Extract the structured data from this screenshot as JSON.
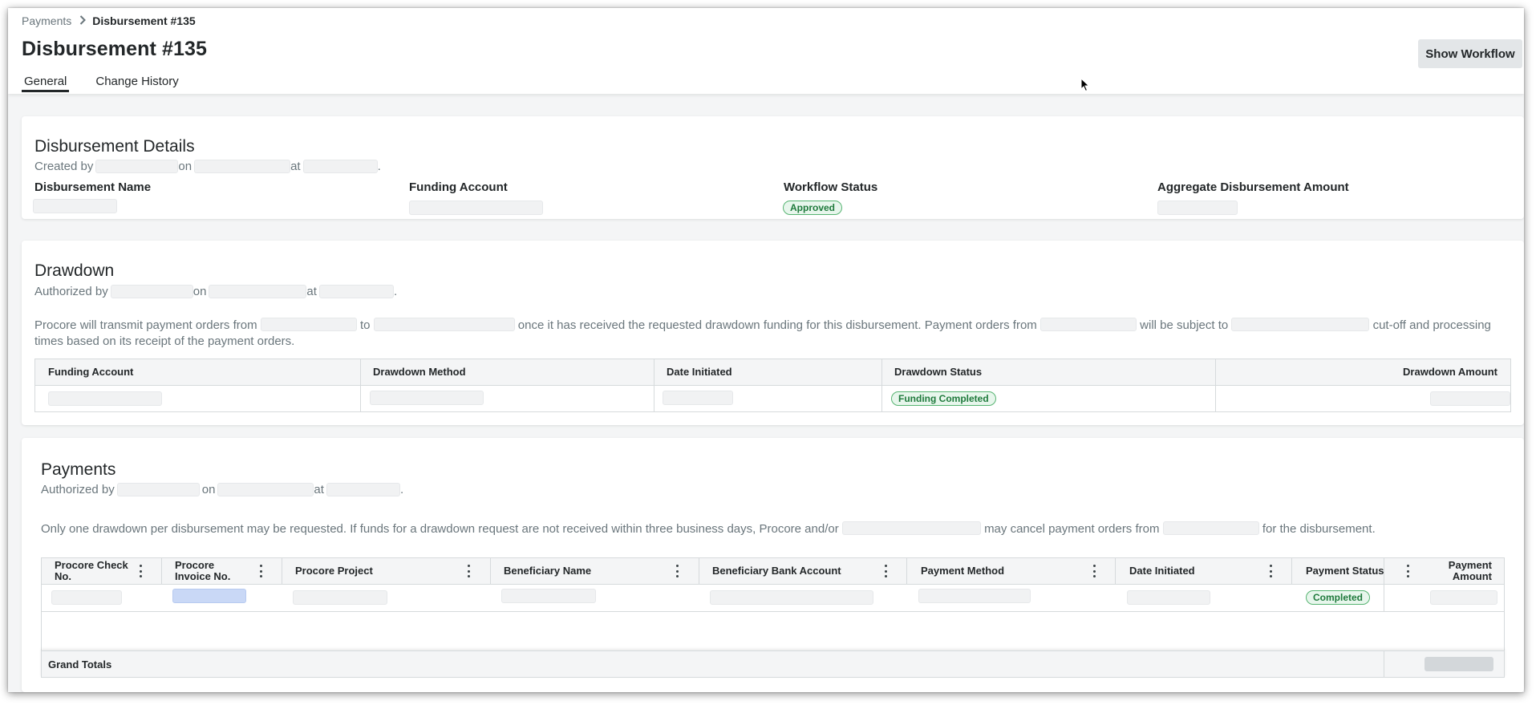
{
  "breadcrumb": {
    "parent": "Payments",
    "current": "Disbursement #135"
  },
  "page": {
    "title": "Disbursement #135"
  },
  "actions": {
    "show_workflow": "Show Workflow"
  },
  "tabs": [
    {
      "label": "General",
      "active": true
    },
    {
      "label": "Change History",
      "active": false
    }
  ],
  "details": {
    "title": "Disbursement Details",
    "created_by": "Created by",
    "on": "on",
    "at": "at",
    "period": ".",
    "fields": {
      "name_label": "Disbursement Name",
      "funding_account_label": "Funding Account",
      "workflow_status_label": "Workflow Status",
      "workflow_status_value": "Approved",
      "aggregate_label": "Aggregate Disbursement Amount"
    }
  },
  "drawdown": {
    "title": "Drawdown",
    "authorized_by": "Authorized by",
    "on": "on",
    "at": "at",
    "period": ".",
    "para_1": "Procore will transmit payment orders from",
    "para_2": "to",
    "para_3": "once it has received the requested drawdown funding for this disbursement. Payment orders from",
    "para_4": "will be subject to",
    "para_5": "cut-off and processing",
    "para_6": "times based on its receipt of the payment orders.",
    "columns": {
      "funding_account": "Funding Account",
      "drawdown_method": "Drawdown Method",
      "date_initiated": "Date Initiated",
      "drawdown_status": "Drawdown Status",
      "drawdown_amount": "Drawdown Amount"
    },
    "row_status": "Funding Completed"
  },
  "payments": {
    "title": "Payments",
    "authorized_by": "Authorized by",
    "on": "on",
    "at": "at",
    "period": ".",
    "para_1": "Only one drawdown per disbursement may be requested. If funds for a drawdown request are not received within three business days, Procore and/or",
    "para_2": "may cancel payment orders from",
    "para_3": "for the disbursement.",
    "columns": {
      "check_no": "Procore Check No.",
      "invoice_no": "Procore Invoice No.",
      "project": "Procore Project",
      "beneficiary_name": "Beneficiary Name",
      "beneficiary_bank": "Beneficiary Bank Account",
      "payment_method": "Payment Method",
      "date_initiated": "Date Initiated",
      "payment_status": "Payment Status",
      "payment_amount": "Payment Amount"
    },
    "row_status": "Completed",
    "grand_totals": "Grand Totals"
  },
  "colors": {
    "success_bg": "#e7f6ec",
    "success_text": "#1f7a3c",
    "success_border": "#57b472",
    "link_blue": "#c9d8f6"
  },
  "icons": [
    "chevron-right-icon",
    "kebab-menu-icon",
    "mouse-pointer-icon"
  ]
}
